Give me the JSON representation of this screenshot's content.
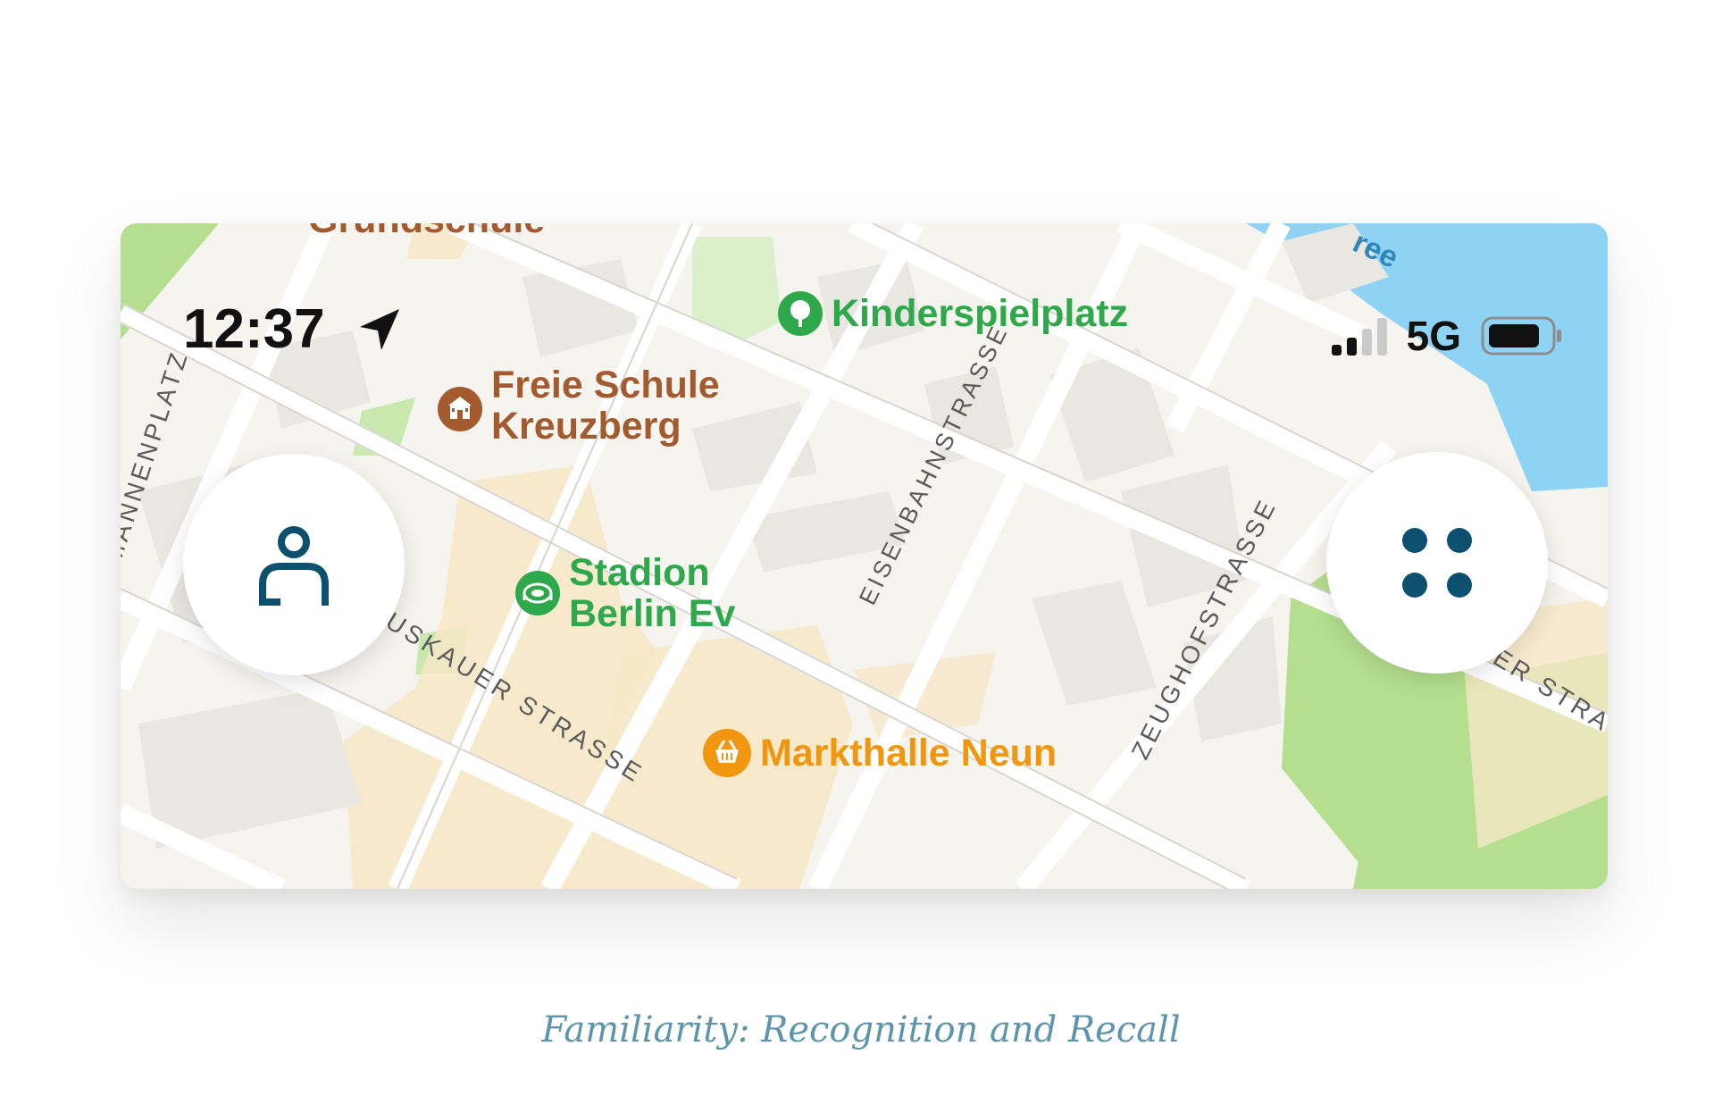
{
  "status_bar": {
    "time": "12:37",
    "location_icon": "location-arrow-icon",
    "signal_icon": "cellular-signal-icon",
    "network_type": "5G",
    "battery_icon": "battery-icon"
  },
  "map": {
    "pois": [
      {
        "name": "Kinderspielplatz",
        "icon": "tree-icon",
        "color": "#2ea84a"
      },
      {
        "name": "Freie Schule\nKreuzberg",
        "icon": "school-icon",
        "color": "#a35a2f"
      },
      {
        "name": "Stadion\nBerlin Ev",
        "icon": "stadium-icon",
        "color": "#2ea84a"
      },
      {
        "name": "Markthalle Neun",
        "icon": "basket-icon",
        "color": "#f0960f"
      }
    ],
    "streets": [
      "Mannenplatz",
      "Eisenbahnstraße",
      "Muskauer Straße",
      "Zeughofstraße",
      "er Stra"
    ],
    "partial_labels": [
      "Grundschule",
      "ree"
    ]
  },
  "buttons": {
    "profile": {
      "icon": "person-icon"
    },
    "menu": {
      "icon": "four-dots-icon"
    }
  },
  "colors": {
    "accent": "#0d4f6e",
    "water": "#8fd3f4",
    "park": "#b5df8f"
  },
  "caption": "Familiarity: Recognition and Recall"
}
